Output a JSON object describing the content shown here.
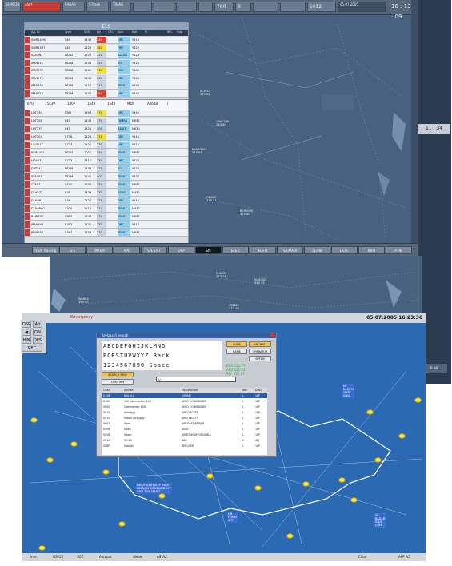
{
  "top": {
    "topbar": {
      "sector": "SEMCON",
      "alert_label": "Alert",
      "radar": "RADAR",
      "track": "S-Track",
      "trans": "TRANS",
      "lmb": "",
      "qnh": "780",
      "value2": "8",
      "fl": "1012",
      "clock": "16 : 13 : 09",
      "date": "05.07.2005"
    },
    "els": {
      "title": "ELS",
      "headers": [
        "A/C ID",
        "Type",
        "SSR",
        "Lvl",
        "CFL",
        "Spd",
        "Exit",
        "Pt",
        "RFL",
        "Flag"
      ],
      "rows": [
        {
          "cs": "SWR1SHS",
          "typ": "E45",
          "sq": "1436",
          "lv": "240",
          "cfl": "",
          "spd": "ORC",
          "ex": "Y410",
          "pt": "",
          "rf": "",
          "fl": "",
          "flags": "r"
        },
        {
          "cs": "SWR1597",
          "typ": "E45",
          "sq": "1426",
          "lv": "360",
          "cfl": "",
          "spd": "ORC",
          "ex": "Y420",
          "pt": "",
          "rf": "",
          "fl": "",
          "flags": "y"
        },
        {
          "cs": "SAG982",
          "typ": "MD82",
          "sq": "1527",
          "lv": "320",
          "cfl": "",
          "spd": "RZGSE",
          "ex": "Y428",
          "pt": "",
          "rf": "",
          "fl": "",
          "flags": ""
        },
        {
          "cs": "IRA9921",
          "typ": "MD88",
          "sq": "1533",
          "lv": "320",
          "cfl": "",
          "spd": "SOI",
          "ex": "Y428",
          "pt": "",
          "rf": "",
          "fl": "",
          "flags": ""
        },
        {
          "cs": "IRA9752",
          "typ": "MD88",
          "sq": "1541",
          "lv": "330",
          "cfl": "",
          "spd": "ORC",
          "ex": "Y440",
          "pt": "",
          "rf": "",
          "fl": "",
          "flags": "y"
        },
        {
          "cs": "IRA9972",
          "typ": "MD88",
          "sq": "1432",
          "lv": "330",
          "cfl": "",
          "spd": "ORC",
          "ex": "Y440",
          "pt": "",
          "rf": "",
          "fl": "",
          "flags": ""
        },
        {
          "cs": "IRA9850",
          "typ": "MD88",
          "sq": "1418",
          "lv": "340",
          "cfl": "",
          "spd": "SBSK",
          "ex": "Y440",
          "pt": "",
          "rf": "",
          "fl": "",
          "flags": ""
        },
        {
          "cs": "IRA9818",
          "typ": "MD88",
          "sq": "1535",
          "lv": "340",
          "cfl": "",
          "spd": "ORC",
          "ex": "Y448",
          "pt": "",
          "rf": "",
          "fl": "",
          "flags": "r"
        },
        {
          "cs": "LOT330",
          "typ": "CRJ2",
          "sq": "1503",
          "lv": "370",
          "cfl": "",
          "spd": "ORC",
          "ex": "Y450",
          "pt": "",
          "rf": "",
          "fl": "",
          "flags": "y"
        },
        {
          "cs": "LOT208",
          "typ": "E45",
          "sq": "1435",
          "lv": "370",
          "cfl": "",
          "spd": "FAMRA",
          "ex": "N630",
          "pt": "",
          "rf": "",
          "fl": "",
          "flags": ""
        },
        {
          "cs": "LOT270",
          "typ": "E45",
          "sq": "1424",
          "lv": "300",
          "cfl": "",
          "spd": "BAVLT",
          "ex": "N630",
          "pt": "",
          "rf": "",
          "fl": "",
          "flags": ""
        },
        {
          "cs": "LOT204",
          "typ": "B738",
          "sq": "1423",
          "lv": "370",
          "cfl": "",
          "spd": "ORC",
          "ex": "Y414",
          "pt": "",
          "rf": "",
          "fl": "",
          "flags": "y"
        },
        {
          "cs": "LAJ4017",
          "typ": "B737",
          "sq": "1421",
          "lv": "230",
          "cfl": "",
          "spd": "ORC",
          "ex": "Y414",
          "pt": "",
          "rf": "",
          "fl": "",
          "flags": ""
        },
        {
          "cs": "KLM1452",
          "typ": "MD82",
          "sq": "1022",
          "lv": "340",
          "cfl": "",
          "spd": "SBSK",
          "ex": "N630",
          "pt": "",
          "rf": "",
          "fl": "",
          "flags": ""
        },
        {
          "cs": "HOA031",
          "typ": "B733",
          "sq": "1417",
          "lv": "330",
          "cfl": "",
          "spd": "ORC",
          "ex": "Y420",
          "pt": "",
          "rf": "",
          "fl": "",
          "flags": ""
        },
        {
          "cs": "DRT914",
          "typ": "MD88",
          "sq": "1433",
          "lv": "370",
          "cfl": "",
          "spd": "SOI",
          "ex": "Y420",
          "pt": "",
          "rf": "",
          "fl": "",
          "flags": ""
        },
        {
          "cs": "SPA402",
          "typ": "MD88",
          "sq": "1541",
          "lv": "400",
          "cfl": "",
          "spd": "SBSK",
          "ex": "Y430",
          "pt": "",
          "rf": "",
          "fl": "",
          "flags": ""
        },
        {
          "cs": "CYA57",
          "typ": "L410",
          "sq": "1530",
          "lv": "350",
          "cfl": "",
          "spd": "SBSK",
          "ex": "N630",
          "pt": "",
          "rf": "",
          "fl": "",
          "flags": ""
        },
        {
          "cs": "DLH272",
          "typ": "B38",
          "sq": "1433",
          "lv": "370",
          "cfl": "",
          "spd": "ASNS",
          "ex": "N430",
          "pt": "",
          "rf": "",
          "fl": "",
          "flags": ""
        },
        {
          "cs": "DLH863",
          "typ": "B38",
          "sq": "1427",
          "lv": "370",
          "cfl": "",
          "spd": "ORC",
          "ex": "Y414",
          "pt": "",
          "rf": "",
          "fl": "",
          "flags": ""
        },
        {
          "cs": "DLH9860",
          "typ": "A320",
          "sq": "1410",
          "lv": "310",
          "cfl": "",
          "spd": "SBSK",
          "ex": "N430",
          "pt": "",
          "rf": "",
          "fl": "",
          "flags": ""
        },
        {
          "cs": "BAW755",
          "typ": "L363",
          "sq": "1433",
          "lv": "370",
          "cfl": "",
          "spd": "SBSK",
          "ex": "N630",
          "pt": "",
          "rf": "",
          "fl": "",
          "flags": ""
        },
        {
          "cs": "IRA9993",
          "typ": "B387",
          "sq": "1522",
          "lv": "370",
          "cfl": "",
          "spd": "ORC",
          "ex": "Y414",
          "pt": "",
          "rf": "",
          "fl": "",
          "flags": ""
        },
        {
          "cs": "JBU8402",
          "typ": "B387",
          "sq": "1533",
          "lv": "230",
          "cfl": "",
          "spd": "SBSK",
          "ex": "N630",
          "pt": "",
          "rf": "",
          "fl": "",
          "flags": ""
        }
      ],
      "edit_row": [
        "670",
        "5k39",
        "180P",
        "1549",
        "1549",
        "MDS",
        "A2628",
        "/"
      ]
    },
    "bottom_buttons": [
      "TOBY\nTraining",
      "ELS",
      "INTEM",
      "APL",
      "SPL LIST",
      "SISP",
      "SIS",
      "ELS C",
      "ELS D",
      "SIGMA-A",
      "CLIMB",
      "DESC",
      "INFO",
      "P-INF"
    ],
    "selected_button": "SIS",
    "side_clock": "11 : 34",
    "side_button": "P-INF"
  },
  "map_labels": [
    {
      "t": "SCWK7\n270 21",
      "cls": "m1"
    },
    {
      "t": "CRACOW\n240 40",
      "cls": "m2"
    },
    {
      "t": "BLAR0005\n240 84",
      "cls": "m3"
    },
    {
      "t": "OEADE\n370 27",
      "cls": "m4"
    },
    {
      "t": "BLR0005\n370 40",
      "cls": "m5"
    },
    {
      "t": "EHACM\n270 24",
      "cls": "m6"
    },
    {
      "t": "KLM302\n340 45",
      "cls": "m7"
    },
    {
      "t": "WAR62\n390 40",
      "cls": "m8"
    },
    {
      "t": "CSEWS\n370 28",
      "cls": "m9"
    }
  ],
  "bottom": {
    "emergency": "Emergency",
    "datetime": "05.07.2005 16:23:36",
    "nav": [
      "DSP",
      "Alt",
      "ON",
      "HIN",
      "DES",
      "REC"
    ],
    "bottom_buttons": [
      "Info",
      "OS-OS",
      "SOC",
      "Autopat",
      "Weber",
      "ASTAZ",
      "Clear",
      "APP RC"
    ],
    "dialog": {
      "title": "Keyboard search",
      "keyboard": [
        "ABCDEFGHIJKLMNO",
        "PQRSTUVWXYZ Back",
        "1234567890 Space"
      ],
      "buttons": [
        "CODE",
        "AIRCRAFT",
        "NAME",
        "OPERATOR",
        "SPEDB"
      ],
      "find": "SEARCH NEW",
      "confirm": "CONFIRM",
      "search_value": "V",
      "columns": [
        "Code",
        "Aircraft",
        "Manufacturer",
        "Wtc",
        "Descr"
      ],
      "rows": [
        [
          "V108",
          "600-VLA",
          "DYNAM",
          "L",
          "1LP"
        ],
        [
          "V100",
          "100 Commander 100",
          "AERO COMMANDER",
          "L",
          "1LP"
        ],
        [
          "V000",
          "Commander 100",
          "AERO COMMANDER",
          "L",
          "1LP"
        ],
        [
          "V015",
          "Airbuggy",
          "AIRCONCEPT",
          "L",
          "1LP"
        ],
        [
          "V015",
          "Vuto-II Airbuggy",
          "AIRCONCEPT",
          "L",
          "1LP"
        ],
        [
          "V007",
          "Viper",
          "AIRCRAFT SPEIJER",
          "L",
          "1LP"
        ],
        [
          "V006",
          "Vixen",
          "AVIAT",
          "L",
          "1LP"
        ],
        [
          "V508",
          "Vision",
          "AVIATION AFFORDABLE",
          "L",
          "1LP"
        ],
        [
          "VC10",
          "VC-10",
          "BAC",
          "H",
          "4RJ"
        ],
        [
          "V08P",
          "Special",
          "BEECHER",
          "L",
          "1LP"
        ]
      ]
    },
    "status": [
      "ENR 121.27",
      "ARR 121.22",
      "APP 121.07"
    ],
    "boxes": [
      {
        "t": "EK\nKAS/FM\nTWR\nGND",
        "cls": "bx1"
      },
      {
        "t": "DRS/FM/ARR/APP 9000\n8600-FM BRAND/OB APP\nGND TWR MAND",
        "cls": "bx2"
      },
      {
        "t": "DN\nFOMM\nAPP",
        "cls": "bx3"
      },
      {
        "t": "KE\nRADAR\nGND\nCOM",
        "cls": "bx4"
      }
    ]
  }
}
